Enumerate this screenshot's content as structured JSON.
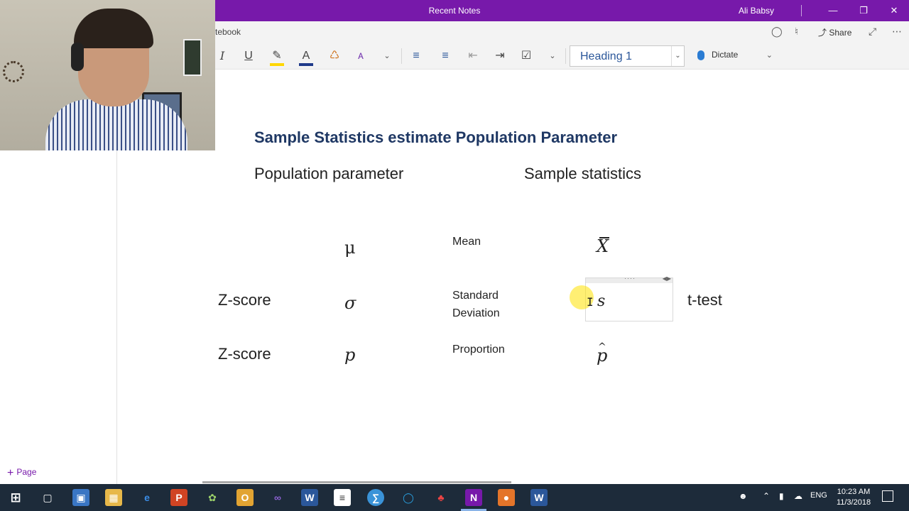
{
  "window": {
    "title": "Recent Notes",
    "user": "Ali Babsy",
    "controls": {
      "minimize": "—",
      "restore": "❐",
      "close": "✕"
    }
  },
  "subbar": {
    "notebook_label": "tebook",
    "share_label": "Share",
    "icons": [
      "lightbulb-icon",
      "bell-icon",
      "share-icon",
      "expand-icon",
      "more-icon"
    ]
  },
  "ribbon": {
    "italic": "I",
    "underline": "U",
    "font_color_glyph": "A",
    "style_value": "Heading 1",
    "dictate_label": "Dictate",
    "colors": {
      "highlight": "#ffd700",
      "font_color": "#1f3a8a"
    }
  },
  "page": {
    "title": "Sample Statistics estimate Population Parameter",
    "col_population": "Population parameter",
    "col_sample": "Sample statistics",
    "rows": [
      {
        "left": "",
        "param": "μ",
        "name": "Mean",
        "name2": "",
        "stat": "X",
        "right": ""
      },
      {
        "left": "Z-score",
        "param": "σ",
        "name": "Standard",
        "name2": "Deviation",
        "stat": "s",
        "right": "t-test"
      },
      {
        "left": "Z-score",
        "param": "p",
        "name": "Proportion",
        "name2": "",
        "stat": "p",
        "right": ""
      }
    ]
  },
  "leftpane": {
    "add_page_label": "Page"
  },
  "taskbar": {
    "language": "ENG",
    "time": "10:23 AM",
    "date": "11/3/2018",
    "apps": [
      "W",
      "N",
      "W"
    ]
  },
  "colors": {
    "onenote_purple": "#7719aa",
    "title_blue": "#1f3864",
    "taskbar": "#1d2b3a"
  }
}
